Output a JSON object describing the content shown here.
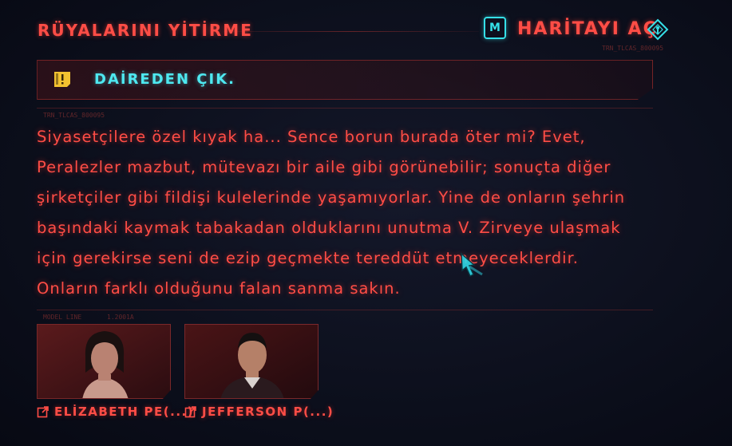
{
  "quest": {
    "title": "RÜYALARINI YİTİRME"
  },
  "map_button": {
    "key": "M",
    "label": "HARİTAYI AÇ",
    "icon": "map-marker-diamond-icon"
  },
  "debug_tags": {
    "top_right": "TRN_TLCAS_800095",
    "above_text": "TRN_TLCAS_800095",
    "model_line": "MODEL LINE",
    "model_version": "1.2001A"
  },
  "objective": {
    "icon": "quest-objective-icon",
    "text": "DAİREDEN ÇIK."
  },
  "message": {
    "lines": [
      "Siyasetçilere özel kıyak ha... Sence borun burada öter mi? Evet,",
      "Peralezler mazbut, mütevazı bir aile gibi görünebilir; sonuçta diğer",
      "şirketçiler gibi fildişi kulelerinde yaşamıyorlar. Yine de onların şehrin",
      "başındaki kaymak tabakadan olduklarını unutma V. Zirveye ulaşmak",
      "için gerekirse seni de ezip geçmekte tereddüt etmeyeceklerdir.",
      "Onların farklı olduğunu falan sanma sakın."
    ]
  },
  "contacts": [
    {
      "name": "ELİZABETH PE(...)",
      "icon": "external-link-icon"
    },
    {
      "name": "JEFFERSON P(...)",
      "icon": "external-link-icon"
    }
  ],
  "colors": {
    "accent_red": "#ff4d46",
    "accent_cyan": "#4ee8f0",
    "objective_yellow": "#f2c230",
    "background": "#0c0f1c"
  }
}
